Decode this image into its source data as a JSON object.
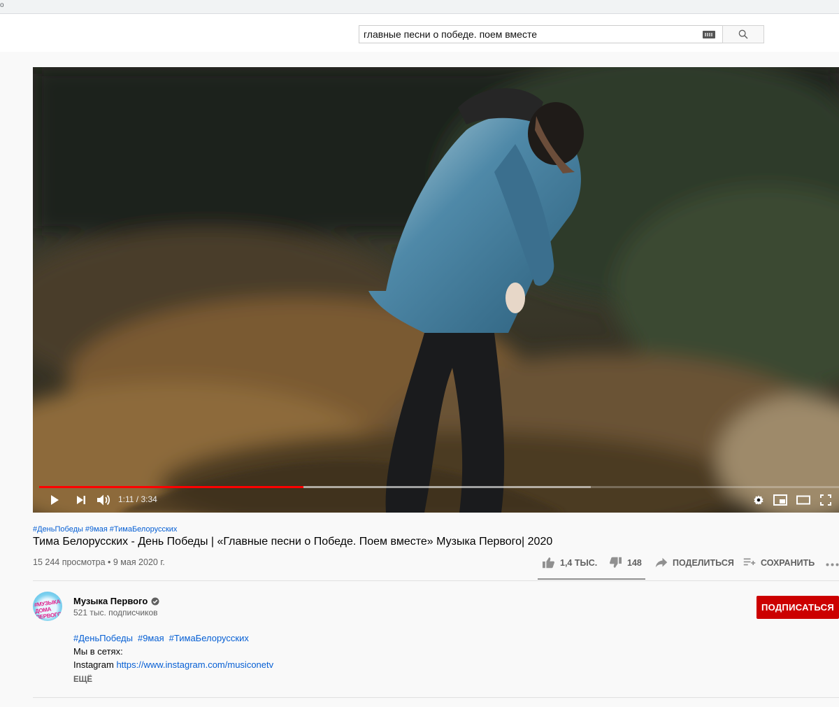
{
  "search": {
    "query": "главные песни о победе. поем вместе",
    "keyboard_icon": "keyboard-icon",
    "button_icon": "search-icon"
  },
  "player": {
    "current_time": "1:11 / 3:34",
    "played_fraction": 0.33,
    "buffered_fraction": 0.69,
    "progress_color": "#ff0000"
  },
  "video": {
    "hashtags": [
      "#ДеньПобеды",
      "#9мая",
      "#ТимаБелорусских"
    ],
    "title": "Тима Белорусских - День Победы | «Главные песни о Победе. Поем вместе» Музыка Первого| 2020",
    "views_date": "15 244 просмотра • 9 мая 2020 г.",
    "likes": "1,4 ТЫС.",
    "dislikes": "148",
    "share_label": "ПОДЕЛИТЬСЯ",
    "save_label": "СОХРАНИТЬ"
  },
  "channel": {
    "name": "Музыка Первого",
    "subscribers": "521 тыс. подписчиков",
    "subscribe_label": "ПОДПИСАТЬСЯ",
    "avatar_text": "#МУЗЫКА ДОМА ПЕРВОГО",
    "accent_color": "#cc0000"
  },
  "description": {
    "hashtags": [
      "#ДеньПобеды",
      "#9мая",
      "#ТимаБелорусских"
    ],
    "line1": "Мы в сетях:",
    "line2_prefix": "Instagram",
    "line2_link": "https://www.instagram.com/musiconetv",
    "more_label": "ЕЩЁ"
  }
}
